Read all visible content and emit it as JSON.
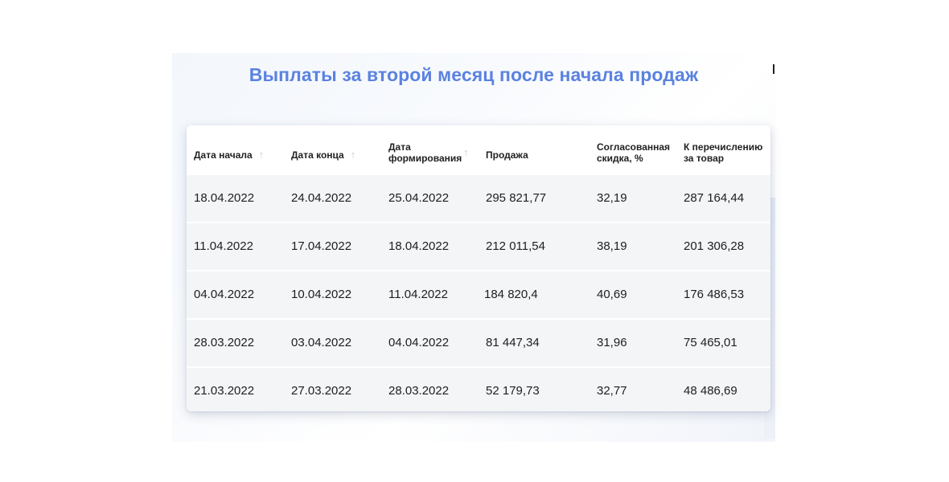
{
  "title": "Выплаты за второй месяц после начала продаж",
  "table": {
    "headers": [
      {
        "line1": "Дата начала",
        "line2": "",
        "sortable": true
      },
      {
        "line1": "Дата конца",
        "line2": "",
        "sortable": true
      },
      {
        "line1": "Дата",
        "line2": "формирования",
        "sortable": true
      },
      {
        "line1": "Продажа",
        "line2": "",
        "sortable": false
      },
      {
        "line1": "Согласованная",
        "line2": "скидка, %",
        "sortable": false
      },
      {
        "line1": "К перечислению",
        "line2": "за товар",
        "sortable": false
      }
    ],
    "sort_icon": "arrow-up-icon",
    "sort_glyph": "↑",
    "rows": [
      [
        "18.04.2022",
        "24.04.2022",
        "25.04.2022",
        "295 821,77",
        "32,19",
        "287 164,44"
      ],
      [
        "11.04.2022",
        "17.04.2022",
        "18.04.2022",
        "212 011,54",
        "38,19",
        "201 306,28"
      ],
      [
        "04.04.2022",
        "10.04.2022",
        "11.04.2022",
        "184 820,4",
        "40,69",
        "176 486,53"
      ],
      [
        "28.03.2022",
        "03.04.2022",
        "04.04.2022",
        "81 447,34",
        "31,96",
        "75 465,01"
      ],
      [
        "21.03.2022",
        "27.03.2022",
        "28.03.2022",
        "52 179,73",
        "32,77",
        "48 486,69"
      ]
    ]
  },
  "colors": {
    "title": "#5a82e0",
    "row_bg": "#f4f5f7",
    "text": "#1e1e1e",
    "sort_arrow": "#c9ccd2"
  }
}
